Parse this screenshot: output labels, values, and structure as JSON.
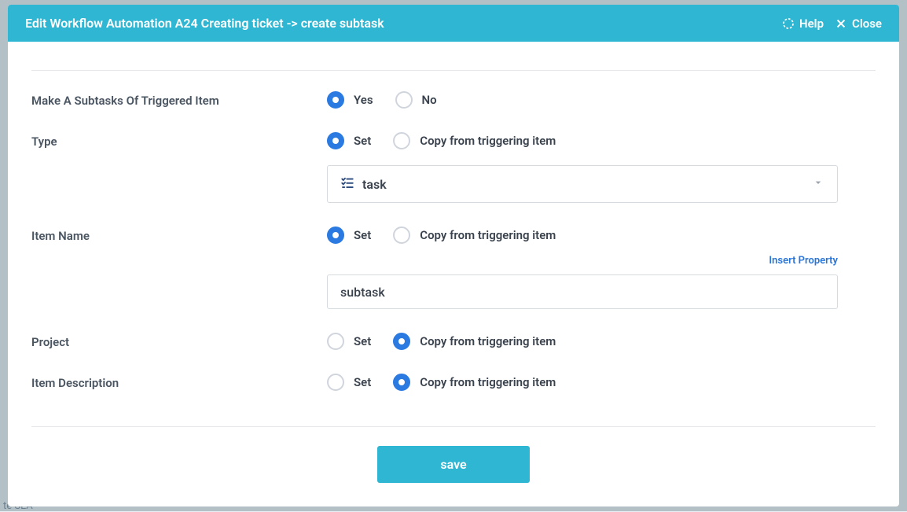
{
  "modal": {
    "title": "Edit Workflow Automation A24 Creating ticket -> create subtask",
    "help_label": "Help",
    "close_label": "Close"
  },
  "fields": {
    "make_subtask": {
      "label": "Make A Subtasks Of Triggered Item",
      "yes": "Yes",
      "no": "No",
      "selected": "yes"
    },
    "type": {
      "label": "Type",
      "set": "Set",
      "copy": "Copy from triggering item",
      "selected": "set",
      "value": "task"
    },
    "item_name": {
      "label": "Item Name",
      "set": "Set",
      "copy": "Copy from triggering item",
      "selected": "set",
      "insert_property": "Insert Property",
      "value": "subtask"
    },
    "project": {
      "label": "Project",
      "set": "Set",
      "copy": "Copy from triggering item",
      "selected": "copy"
    },
    "item_description": {
      "label": "Item Description",
      "set": "Set",
      "copy": "Copy from triggering item",
      "selected": "copy"
    }
  },
  "buttons": {
    "save": "save"
  }
}
